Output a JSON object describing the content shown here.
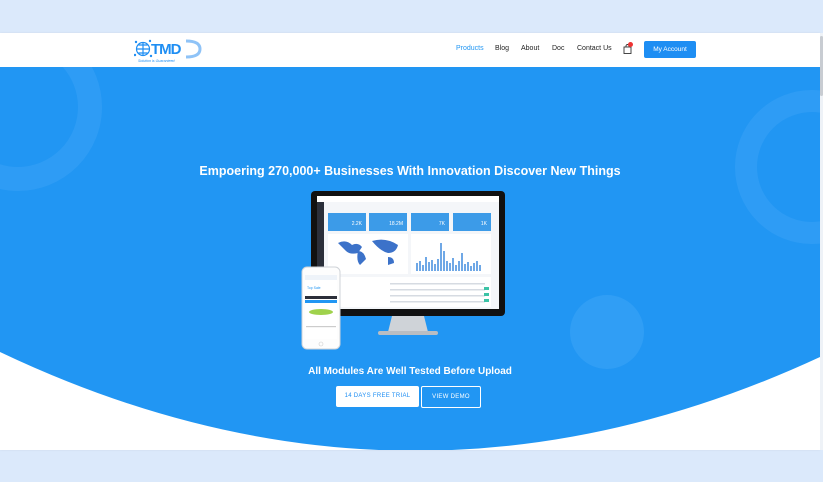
{
  "header": {
    "logo_text": "TMD",
    "logo_tagline": "Solution is Guaranteed",
    "nav": [
      {
        "label": "Products",
        "active": true
      },
      {
        "label": "Blog",
        "active": false
      },
      {
        "label": "About",
        "active": false
      },
      {
        "label": "Doc",
        "active": false
      },
      {
        "label": "Contact Us",
        "active": false
      }
    ],
    "cart_icon": "shopping-bag-icon",
    "account_button": "My Account"
  },
  "hero": {
    "title": "Empoering 270,000+ Businesses With Innovation Discover New Things",
    "subtitle": "All Modules Are Well Tested Before Upload",
    "trial_button": "14 DAYS FREE TRIAL",
    "demo_button": "VIEW DEMO"
  },
  "mockup": {
    "stats": [
      "2.2K",
      "18.2M",
      "7K",
      "1K"
    ]
  },
  "colors": {
    "brand_blue": "#2196f3",
    "hero_blue": "#2196f3",
    "button_blue": "#1e8ef3",
    "background": "#dbe9fb"
  }
}
